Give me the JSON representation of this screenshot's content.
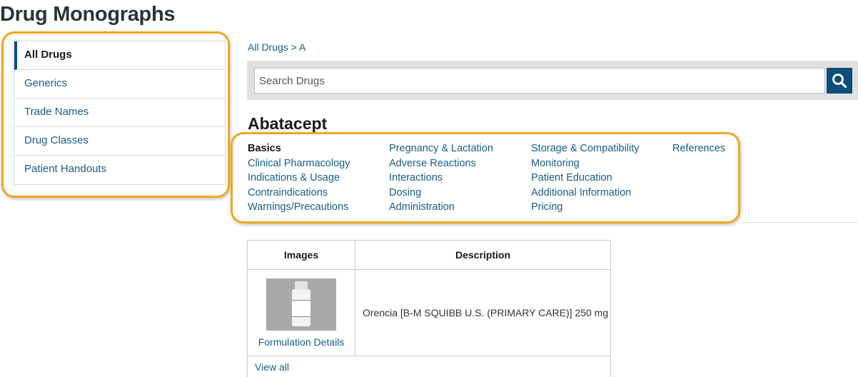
{
  "page_title": "Drug Monographs",
  "sidebar": {
    "items": [
      {
        "label": "All Drugs"
      },
      {
        "label": "Generics"
      },
      {
        "label": "Trade Names"
      },
      {
        "label": "Drug Classes"
      },
      {
        "label": "Patient Handouts"
      }
    ],
    "active_index": 0
  },
  "breadcrumb": {
    "root": "All Drugs",
    "separator": " > ",
    "current": "A"
  },
  "search": {
    "placeholder": "Search Drugs",
    "value": "",
    "button_icon": "search-icon"
  },
  "drug": {
    "name": "Abatacept"
  },
  "sections": {
    "columns": [
      [
        "Basics",
        "Clinical Pharmacology",
        "Indications & Usage",
        "Contraindications",
        "Warnings/Precautions"
      ],
      [
        "Pregnancy & Lactation",
        "Adverse Reactions",
        "Interactions",
        "Dosing",
        "Administration"
      ],
      [
        "Storage & Compatibility",
        "Monitoring",
        "Patient Education",
        "Additional Information",
        "Pricing"
      ],
      [
        "References"
      ]
    ],
    "current": "Basics"
  },
  "images_table": {
    "headers": {
      "images": "Images",
      "description": "Description"
    },
    "rows": [
      {
        "link": "Formulation Details",
        "description": "Orencia [B-M SQUIBB U.S. (PRIMARY CARE)] 250 mg"
      }
    ],
    "view_all": "View all"
  },
  "colors": {
    "link": "#175c8a",
    "accent": "#0d4f7a",
    "highlight": "#f0a81e",
    "search_bg": "#e0e0e0"
  }
}
